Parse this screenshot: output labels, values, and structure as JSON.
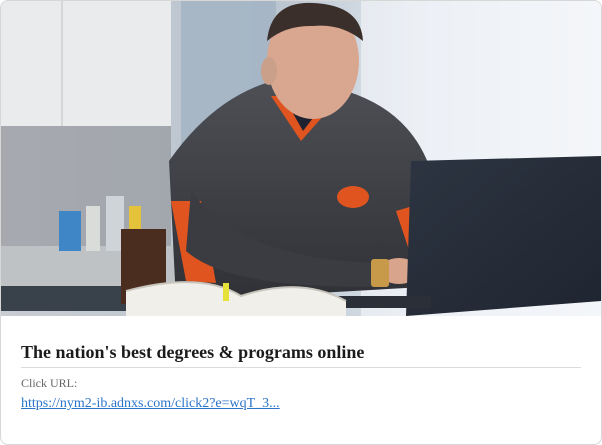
{
  "ad": {
    "image_subject": "man-working-on-laptop-photo",
    "headline": "The nation's best degrees & programs online",
    "click_label": "Click URL:",
    "click_url": "https://nym2-ib.adnxs.com/click2?e=wqT_3..."
  },
  "colors": {
    "link": "#2b74c9",
    "headline": "#1b1b1b",
    "accent_orange": "#e0541f"
  }
}
